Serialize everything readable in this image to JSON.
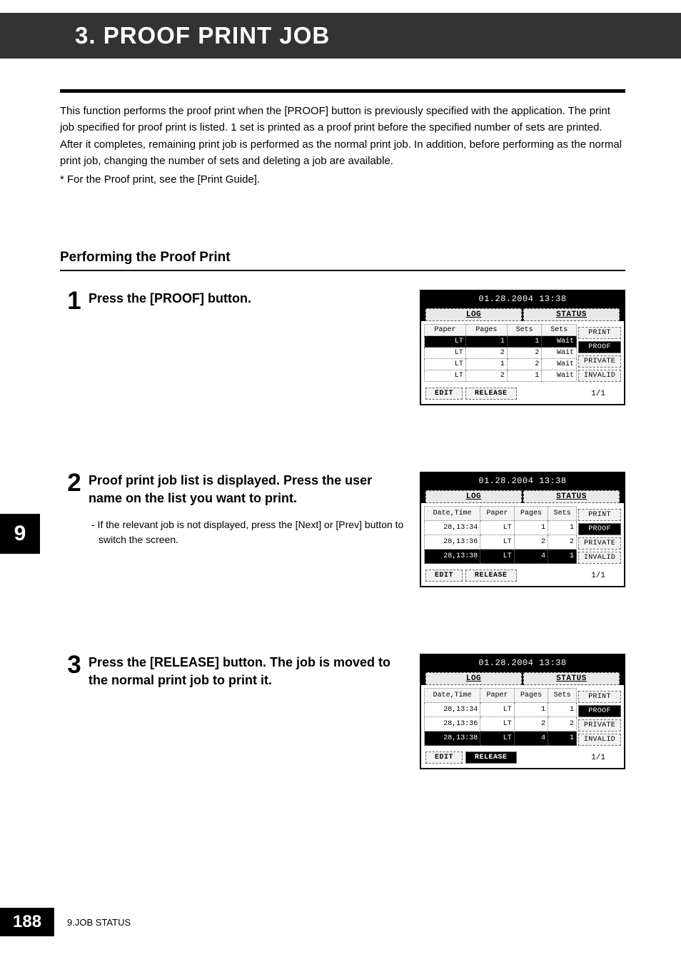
{
  "header": {
    "title": "3. PROOF PRINT JOB"
  },
  "intro": "This function performs the proof print when the [PROOF] button is previously specified with the application. The print job specified for proof print is listed. 1 set is printed as a proof print before the specified number of sets are printed. After it completes, remaining print job is performed as the normal print job. In addition, before performing as the normal print job, changing the number of sets and deleting a job are available.",
  "note": "*  For the Proof print, see the [Print Guide].",
  "section_title": "Performing the Proof Print",
  "steps": [
    {
      "num": "1",
      "heading": "Press the [PROOF] button.",
      "sub": "",
      "panel": {
        "datetime": "01.28.2004 13:38",
        "tabs": [
          "LOG",
          "STATUS"
        ],
        "columns": [
          "Paper",
          "Pages",
          "Sets",
          "Sets"
        ],
        "rows": [
          {
            "cells": [
              "LT",
              "1",
              "1",
              "Wait"
            ],
            "selected": true
          },
          {
            "cells": [
              "LT",
              "2",
              "2",
              "Wait"
            ],
            "selected": false
          },
          {
            "cells": [
              "LT",
              "1",
              "2",
              "Wait"
            ],
            "selected": false
          },
          {
            "cells": [
              "LT",
              "2",
              "1",
              "Wait"
            ],
            "selected": false
          }
        ],
        "side": [
          "PRINT",
          "PROOF",
          "PRIVATE",
          "INVALID"
        ],
        "side_active": 1,
        "bottom": [
          "EDIT",
          "RELEASE"
        ],
        "bottom_active": -1,
        "page": "1/1"
      }
    },
    {
      "num": "2",
      "heading": "Proof print job list is displayed. Press the user name on the list you want to print.",
      "sub": "-  If the relevant job is not displayed, press the [Next] or [Prev] button to switch the screen.",
      "panel": {
        "datetime": "01.28.2004 13:38",
        "tabs": [
          "LOG",
          "STATUS"
        ],
        "columns": [
          "Date,Time",
          "Paper",
          "Pages",
          "Sets"
        ],
        "rows": [
          {
            "cells": [
              "28,13:34",
              "LT",
              "1",
              "1"
            ],
            "selected": false
          },
          {
            "cells": [
              "28,13:36",
              "LT",
              "2",
              "2"
            ],
            "selected": false
          },
          {
            "cells": [
              "28,13:38",
              "LT",
              "4",
              "1"
            ],
            "selected": true
          }
        ],
        "side": [
          "PRINT",
          "PROOF",
          "PRIVATE",
          "INVALID"
        ],
        "side_active": 1,
        "bottom": [
          "EDIT",
          "RELEASE"
        ],
        "bottom_active": -1,
        "page": "1/1"
      }
    },
    {
      "num": "3",
      "heading": "Press the [RELEASE] button. The job is moved to the normal print job to print it.",
      "sub": "",
      "panel": {
        "datetime": "01.28.2004 13:38",
        "tabs": [
          "LOG",
          "STATUS"
        ],
        "columns": [
          "Date,Time",
          "Paper",
          "Pages",
          "Sets"
        ],
        "rows": [
          {
            "cells": [
              "28,13:34",
              "LT",
              "1",
              "1"
            ],
            "selected": false
          },
          {
            "cells": [
              "28,13:36",
              "LT",
              "2",
              "2"
            ],
            "selected": false
          },
          {
            "cells": [
              "28,13:38",
              "LT",
              "4",
              "1"
            ],
            "selected": true
          }
        ],
        "side": [
          "PRINT",
          "PROOF",
          "PRIVATE",
          "INVALID"
        ],
        "side_active": 1,
        "bottom": [
          "EDIT",
          "RELEASE"
        ],
        "bottom_active": 1,
        "page": "1/1"
      }
    }
  ],
  "chapter_tab": "9",
  "footer": {
    "page": "188",
    "label": "9.JOB STATUS"
  }
}
